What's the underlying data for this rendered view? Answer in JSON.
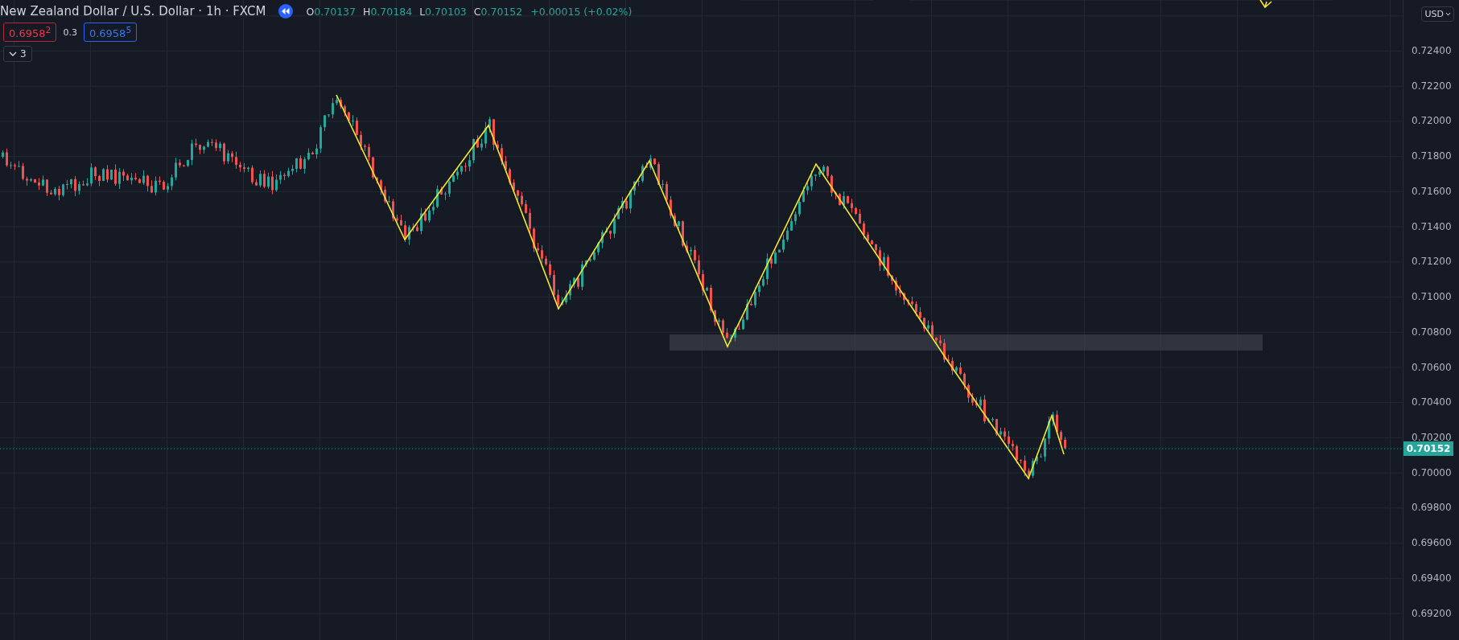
{
  "header": {
    "title": "New Zealand Dollar / U.S. Dollar · 1h · FXCM",
    "ohlc": [
      {
        "label": "O",
        "value": "0.70137"
      },
      {
        "label": "H",
        "value": "0.70184"
      },
      {
        "label": "L",
        "value": "0.70103"
      },
      {
        "label": "C",
        "value": "0.70152"
      }
    ],
    "change": "+0.00015 (+0.02%)"
  },
  "trade": {
    "sell": "0.6958$^{2}$",
    "spread": "0.3",
    "buy": "0.6958$^{5}$"
  },
  "indicators_toggle": {
    "count": "3"
  },
  "price_axis": {
    "currency": "USD",
    "labels": [
      "0.72400",
      "0.72200",
      "0.72000",
      "0.71800",
      "0.71600",
      "0.71400",
      "0.71200",
      "0.71000",
      "0.70800",
      "0.70600",
      "0.70400",
      "0.70200",
      "0.70000",
      "0.69800",
      "0.69600",
      "0.69400",
      "0.69200"
    ],
    "last_price": "0.70152"
  }
}
